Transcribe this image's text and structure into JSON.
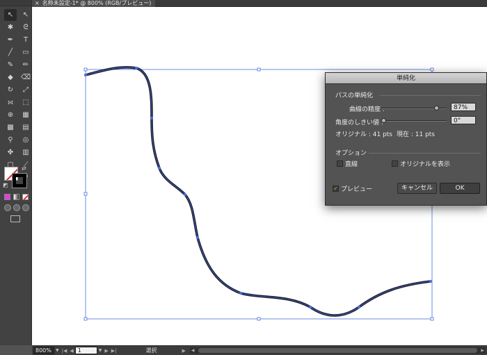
{
  "document_tab": {
    "close_glyph": "×",
    "title": "名称未設定-1* @ 800% (RGB/プレビュー)"
  },
  "toolbox": {
    "tools": [
      {
        "name": "selection-tool-icon",
        "glyph": "↖"
      },
      {
        "name": "direct-selection-tool-icon",
        "glyph": "↖"
      },
      {
        "name": "magic-wand-tool-icon",
        "glyph": "✱"
      },
      {
        "name": "lasso-tool-icon",
        "glyph": "ᘓ"
      },
      {
        "name": "pen-tool-icon",
        "glyph": "✒"
      },
      {
        "name": "type-tool-icon",
        "glyph": "T"
      },
      {
        "name": "line-tool-icon",
        "glyph": "╱"
      },
      {
        "name": "rectangle-tool-icon",
        "glyph": "▭"
      },
      {
        "name": "paintbrush-tool-icon",
        "glyph": "✎"
      },
      {
        "name": "pencil-tool-icon",
        "glyph": "✏"
      },
      {
        "name": "blob-brush-tool-icon",
        "glyph": "◆"
      },
      {
        "name": "eraser-tool-icon",
        "glyph": "⌫"
      },
      {
        "name": "rotate-tool-icon",
        "glyph": "↻"
      },
      {
        "name": "scale-tool-icon",
        "glyph": "⤢"
      },
      {
        "name": "width-tool-icon",
        "glyph": "⟗"
      },
      {
        "name": "free-transform-tool-icon",
        "glyph": "⬚"
      },
      {
        "name": "shape-builder-tool-icon",
        "glyph": "⊕"
      },
      {
        "name": "perspective-grid-tool-icon",
        "glyph": "▦"
      },
      {
        "name": "mesh-tool-icon",
        "glyph": "▩"
      },
      {
        "name": "gradient-tool-icon",
        "glyph": "▤"
      },
      {
        "name": "eyedropper-tool-icon",
        "glyph": "⚲"
      },
      {
        "name": "blend-tool-icon",
        "glyph": "◎"
      },
      {
        "name": "symbol-sprayer-tool-icon",
        "glyph": "✤"
      },
      {
        "name": "column-graph-tool-icon",
        "glyph": "▥"
      },
      {
        "name": "artboard-tool-icon",
        "glyph": "▢"
      },
      {
        "name": "slice-tool-icon",
        "glyph": "⟋"
      },
      {
        "name": "hand-tool-icon",
        "glyph": "✋"
      },
      {
        "name": "zoom-tool-icon",
        "glyph": "⚲"
      }
    ]
  },
  "dialog": {
    "title": "単純化",
    "group_path": "パスの単純化",
    "curve_precision_label": "曲線の精度 :",
    "curve_precision_value": "87%",
    "curve_precision_level": 0.87,
    "angle_threshold_label": "角度のしきい値 :",
    "angle_threshold_value": "0°",
    "angle_threshold_level": 0.0,
    "original_points": "オリジナル : 41 pts",
    "current_points": "現在 : 11 pts",
    "group_options": "オプション",
    "straight_lines_label": "直線",
    "straight_lines_checked": false,
    "show_original_label": "オリジナルを表示",
    "show_original_checked": false,
    "preview_label": "プレビュー",
    "preview_checked": true,
    "check_glyph": "✓",
    "cancel_label": "キャンセル",
    "ok_label": "OK"
  },
  "statusbar": {
    "zoom": "800%",
    "page": "1",
    "status": "選択",
    "dropdown_glyph": "▼",
    "first_glyph": "|◀",
    "prev_glyph": "◀",
    "next_glyph": "▶",
    "last_glyph": "▶|",
    "menu_glyph": "▶",
    "scroll_left_glyph": "◀",
    "scroll_right_glyph": "▶"
  },
  "colors": {
    "selection_blue": "#4a6fe0",
    "path_stroke": "#1c1c28",
    "artboard": "#ffffff",
    "ui_dark": "#535353"
  }
}
